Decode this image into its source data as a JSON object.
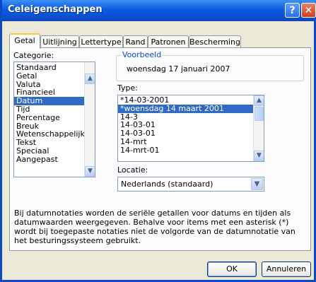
{
  "window": {
    "title": "Celeigenschappen"
  },
  "titlebar": {
    "help_glyph": "?",
    "close_glyph": "✕"
  },
  "tabs": [
    {
      "label": "Getal",
      "active": true
    },
    {
      "label": "Uitlijning"
    },
    {
      "label": "Lettertype"
    },
    {
      "label": "Rand"
    },
    {
      "label": "Patronen"
    },
    {
      "label": "Bescherming"
    }
  ],
  "categorie": {
    "label": "Categorie:",
    "items": [
      "Standaard",
      "Getal",
      "Valuta",
      "Financieel",
      "Datum",
      "Tijd",
      "Percentage",
      "Breuk",
      "Wetenschappelijk",
      "Tekst",
      "Speciaal",
      "Aangepast"
    ],
    "selected": "Datum"
  },
  "voorbeeld": {
    "legend": "Voorbeeld",
    "value": "woensdag 17 januari 2007"
  },
  "type": {
    "label": "Type:",
    "items": [
      "*14-03-2001",
      "*woensdag 14 maart 2001",
      "14-3",
      "14-03-01",
      "14-03-01",
      "14-mrt",
      "14-mrt-01"
    ],
    "selected": "*woensdag 14 maart 2001"
  },
  "locatie": {
    "label": "Locatie:",
    "value": "Nederlands (standaard)"
  },
  "description": "Bij datumnotaties worden de seriële getallen voor datums en tijden als datumwaarden weergegeven. Behalve voor items met een asterisk (*) wordt bij toegepaste notaties niet de volgorde van de datumnotatie van het besturingssysteem gebruikt.",
  "buttons": {
    "ok": "OK",
    "cancel": "Annuleren"
  },
  "colors": {
    "titlebar": "#0a4fd2",
    "selection": "#316ac5",
    "tab_accent": "#ffc83c"
  }
}
